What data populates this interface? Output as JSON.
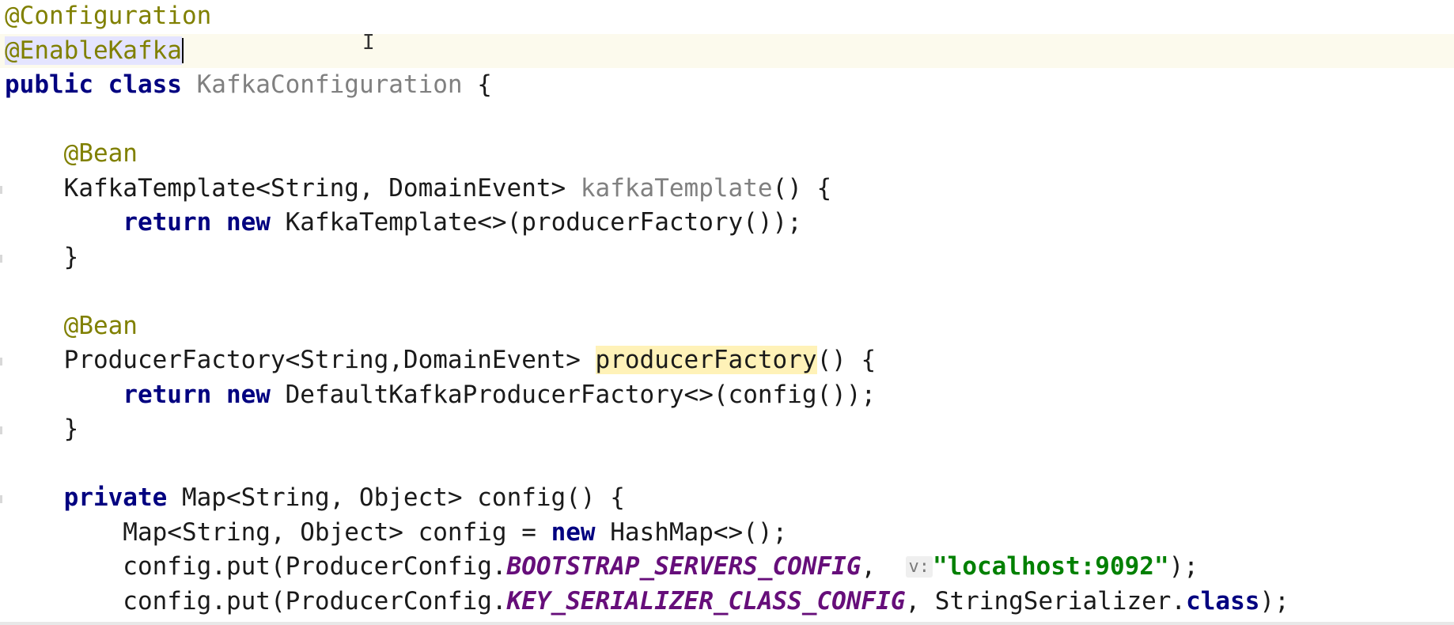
{
  "editor": {
    "lines": [
      {
        "tokens": [
          {
            "text": "@Configuration",
            "kind": "annotation"
          }
        ]
      },
      {
        "tokens": [
          {
            "text": "@EnableKafka",
            "kind": "annotation-sel"
          }
        ],
        "current": true,
        "caret": true
      },
      {
        "tokens": [
          {
            "text": "public ",
            "kind": "keyword"
          },
          {
            "text": "class ",
            "kind": "keyword"
          },
          {
            "text": "KafkaConfiguration",
            "kind": "unused"
          },
          {
            "text": " {",
            "kind": "plain"
          }
        ]
      },
      {
        "tokens": []
      },
      {
        "tokens": [
          {
            "text": "    ",
            "kind": "plain"
          },
          {
            "text": "@Bean",
            "kind": "annotation"
          }
        ]
      },
      {
        "tokens": [
          {
            "text": "    KafkaTemplate<String, DomainEvent> ",
            "kind": "plain"
          },
          {
            "text": "kafkaTemplate",
            "kind": "unused"
          },
          {
            "text": "() {",
            "kind": "plain"
          }
        ],
        "gutter": true
      },
      {
        "tokens": [
          {
            "text": "        ",
            "kind": "plain"
          },
          {
            "text": "return ",
            "kind": "keyword"
          },
          {
            "text": "new ",
            "kind": "keyword"
          },
          {
            "text": "KafkaTemplate<>(producerFactory());",
            "kind": "plain"
          }
        ]
      },
      {
        "tokens": [
          {
            "text": "    }",
            "kind": "plain"
          }
        ],
        "gutter": true
      },
      {
        "tokens": []
      },
      {
        "tokens": [
          {
            "text": "    ",
            "kind": "plain"
          },
          {
            "text": "@Bean",
            "kind": "annotation"
          }
        ]
      },
      {
        "tokens": [
          {
            "text": "    ProducerFactory<String,DomainEvent> ",
            "kind": "plain"
          },
          {
            "text": "producerFactory",
            "kind": "highlight"
          },
          {
            "text": "() {",
            "kind": "plain"
          }
        ],
        "gutter": true
      },
      {
        "tokens": [
          {
            "text": "        ",
            "kind": "plain"
          },
          {
            "text": "return ",
            "kind": "keyword"
          },
          {
            "text": "new ",
            "kind": "keyword"
          },
          {
            "text": "DefaultKafkaProducerFactory<>(config());",
            "kind": "plain"
          }
        ]
      },
      {
        "tokens": [
          {
            "text": "    }",
            "kind": "plain"
          }
        ],
        "gutter": true
      },
      {
        "tokens": []
      },
      {
        "tokens": [
          {
            "text": "    ",
            "kind": "plain"
          },
          {
            "text": "private ",
            "kind": "keyword"
          },
          {
            "text": "Map<String, Object> config() {",
            "kind": "plain"
          }
        ],
        "gutter": true
      },
      {
        "tokens": [
          {
            "text": "        Map<String, Object> config = ",
            "kind": "plain"
          },
          {
            "text": "new ",
            "kind": "keyword"
          },
          {
            "text": "HashMap<>();",
            "kind": "plain"
          }
        ]
      },
      {
        "tokens": [
          {
            "text": "        config.put(ProducerConfig.",
            "kind": "plain"
          },
          {
            "text": "BOOTSTRAP_SERVERS_CONFIG",
            "kind": "const"
          },
          {
            "text": ",  ",
            "kind": "plain"
          },
          {
            "text": "v:",
            "kind": "hint"
          },
          {
            "text": "\"localhost:9092\"",
            "kind": "string"
          },
          {
            "text": ");",
            "kind": "plain"
          }
        ]
      },
      {
        "tokens": [
          {
            "text": "        config.put(ProducerConfig.",
            "kind": "plain"
          },
          {
            "text": "KEY_SERIALIZER_CLASS_CONFIG",
            "kind": "const"
          },
          {
            "text": ", StringSerializer.",
            "kind": "plain"
          },
          {
            "text": "class",
            "kind": "keyword"
          },
          {
            "text": ");",
            "kind": "plain"
          }
        ]
      }
    ]
  },
  "colors": {
    "annotation": "#808000",
    "keyword": "#000080",
    "unused": "#808080",
    "constant": "#660e7a",
    "string": "#008000",
    "current_line": "#fcfaed",
    "usage_highlight": "#fff2b8"
  }
}
